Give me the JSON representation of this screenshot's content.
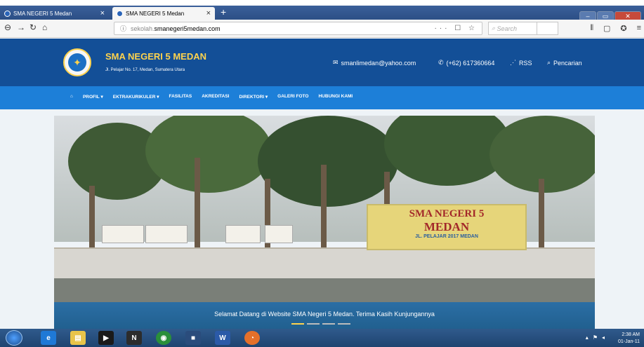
{
  "browser": {
    "tabs": [
      {
        "label": "SMA NEGERI 5 Medan"
      },
      {
        "label": "SMA NEGERI 5 Medan"
      }
    ],
    "url_scheme_part": "sekolah.",
    "url_host": "smanegeri5medan.com",
    "search_placeholder": "Search",
    "url_actions": "··· ☐ ☆"
  },
  "site": {
    "title": "SMA NEGERI 5 MEDAN",
    "address": "Jl. Pelajar No. 17, Medan, Sumatera Utara",
    "email": "smanlimedan@yahoo.com",
    "phone": "(+62) 617360664",
    "rss": "RSS",
    "search": "Pencarian",
    "menu": [
      {
        "label": "PROFIL ▾"
      },
      {
        "label": "EKTRAKURIKULER ▾"
      },
      {
        "label": "FASILITAS"
      },
      {
        "label": "AKREDITASI"
      },
      {
        "label": "DIREKTORI ▾"
      },
      {
        "label": "GALERI FOTO"
      },
      {
        "label": "HUBUNGI KAMI"
      }
    ],
    "hero": {
      "billboard_line1": "SMA NEGERI 5",
      "billboard_line2": "MEDAN",
      "billboard_line3": "JL. PELAJAR 2017 MEDAN",
      "caption": "Selamat Datang di Website SMA Negeri 5 Medan. Terima Kasih Kunjungannya",
      "slides_total": 4,
      "slide_active": 1
    }
  },
  "taskbar": {
    "time": "2:38 AM",
    "date": "01-Jan-11"
  },
  "colors": {
    "header_bg": "#134f97",
    "menu_bg": "#1d7fd8",
    "title_yellow": "#ffd34d"
  }
}
